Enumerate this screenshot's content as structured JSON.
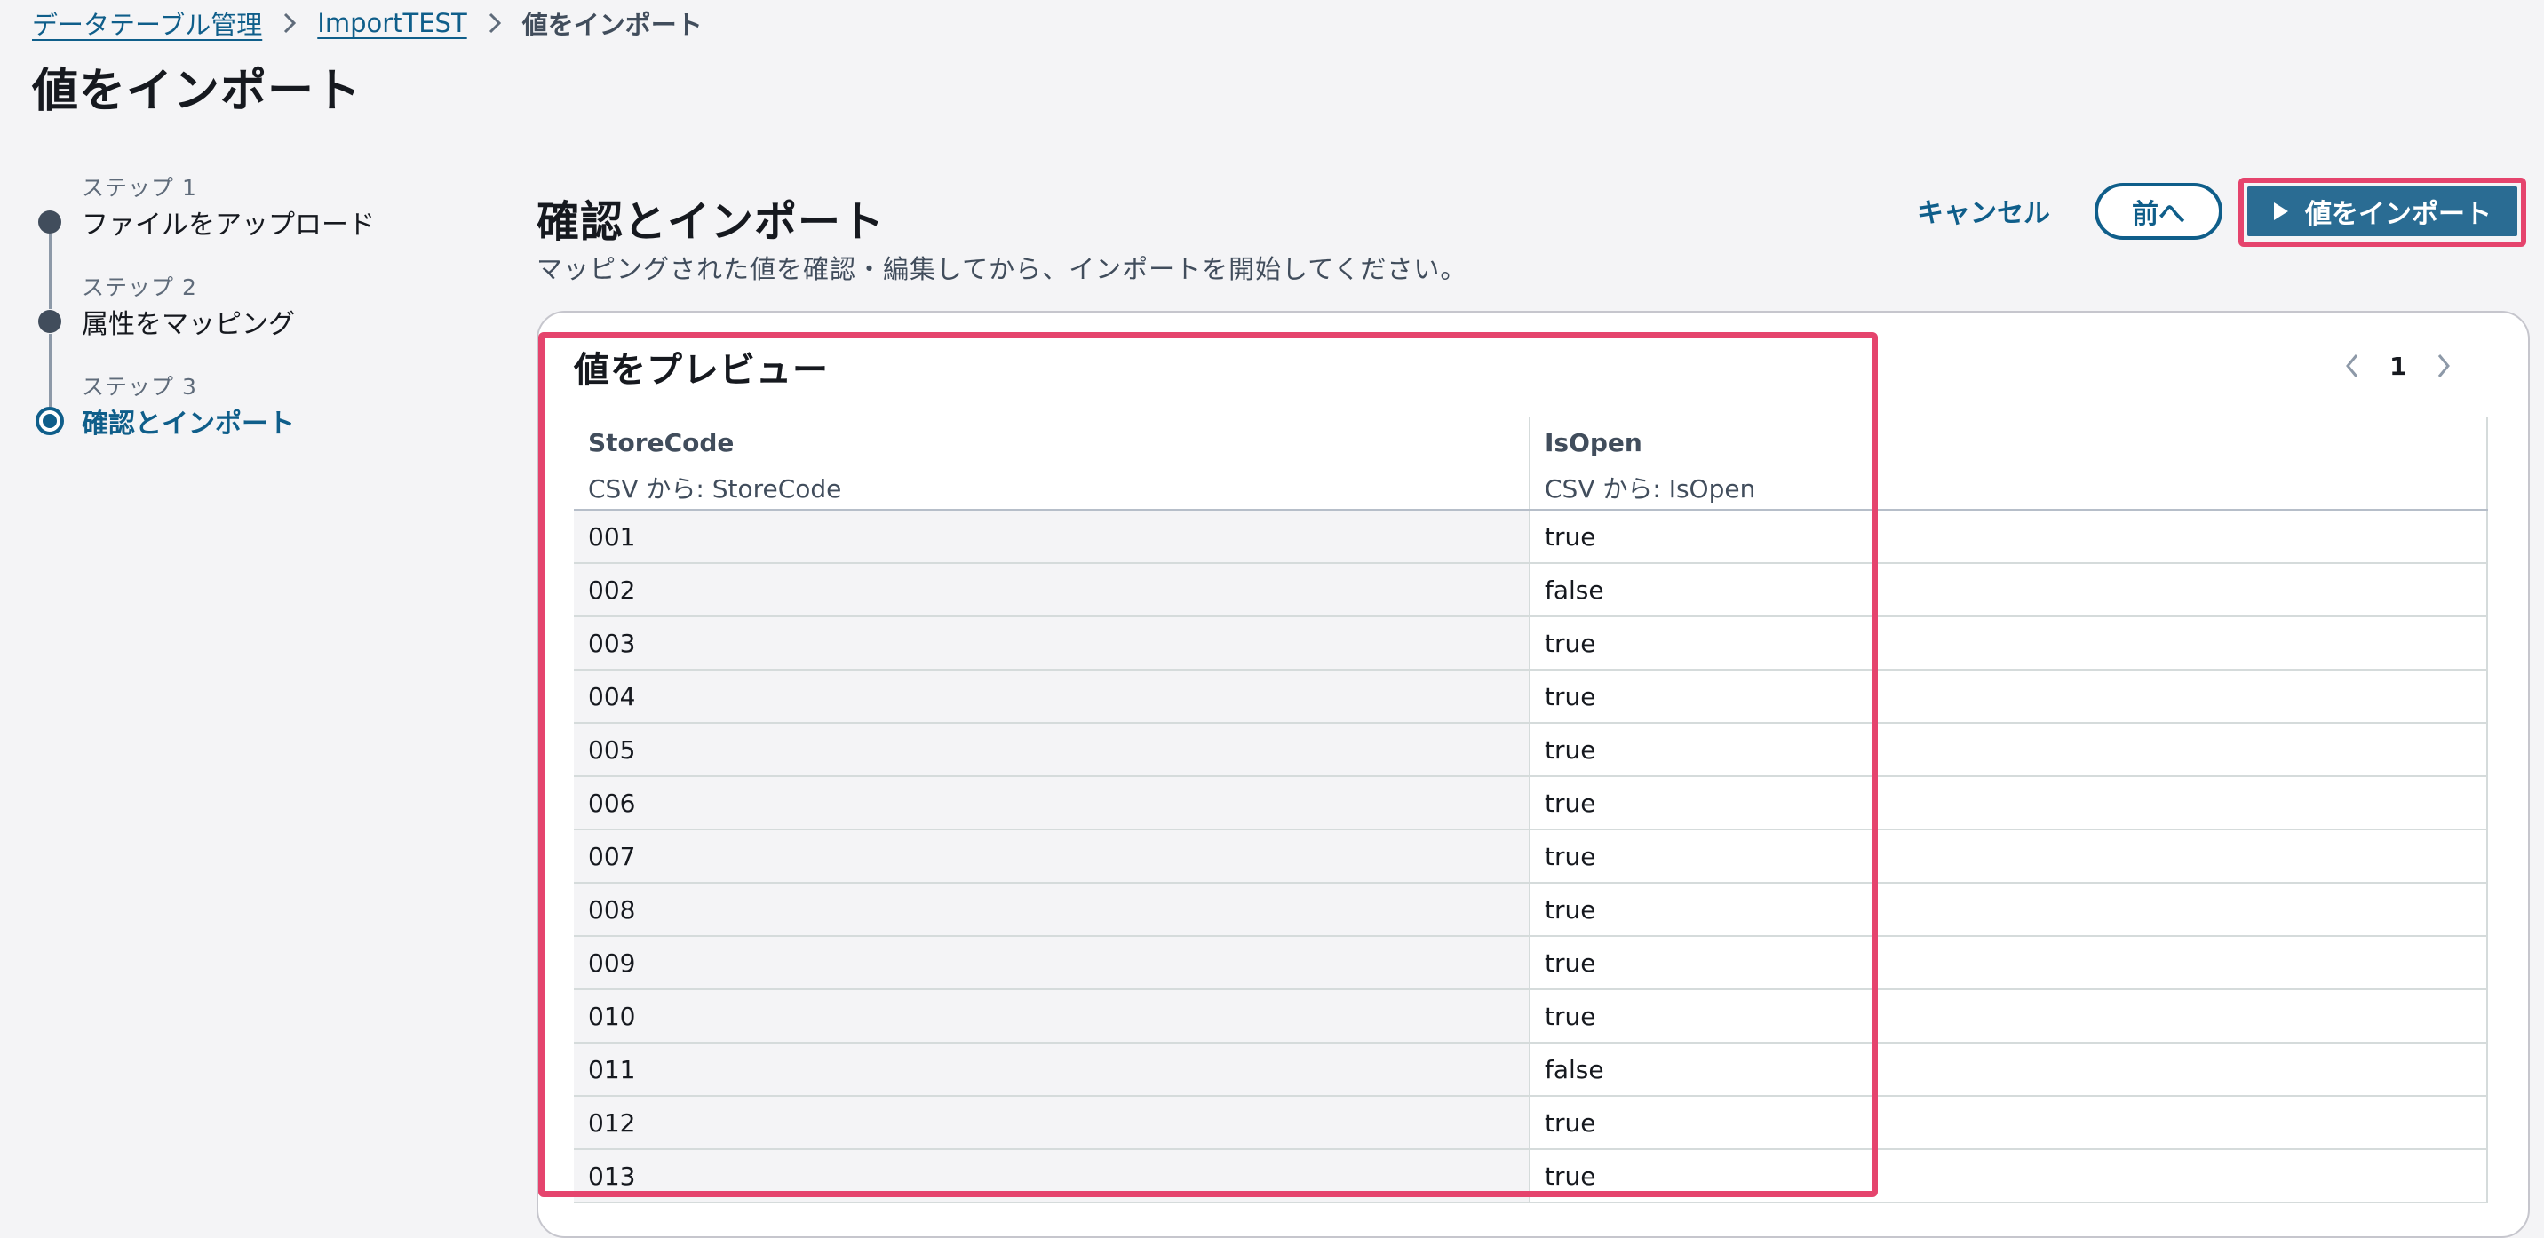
{
  "breadcrumb": {
    "items": [
      "データテーブル管理",
      "ImportTEST"
    ],
    "current": "値をインポート"
  },
  "page_title": "値をインポート",
  "steps": [
    {
      "caption": "ステップ 1",
      "label": "ファイルをアップロード",
      "state": "complete"
    },
    {
      "caption": "ステップ 2",
      "label": "属性をマッピング",
      "state": "complete"
    },
    {
      "caption": "ステップ 3",
      "label": "確認とインポート",
      "state": "active"
    }
  ],
  "section": {
    "title": "確認とインポート",
    "description": "マッピングされた値を確認・編集してから、インポートを開始してください。"
  },
  "actions": {
    "cancel": "キャンセル",
    "previous": "前へ",
    "import": "値をインポート"
  },
  "preview": {
    "title": "値をプレビュー",
    "page": "1",
    "columns": [
      {
        "name": "StoreCode",
        "source": "CSV から: StoreCode"
      },
      {
        "name": "IsOpen",
        "source": "CSV から: IsOpen"
      }
    ],
    "rows": [
      [
        "001",
        "true"
      ],
      [
        "002",
        "false"
      ],
      [
        "003",
        "true"
      ],
      [
        "004",
        "true"
      ],
      [
        "005",
        "true"
      ],
      [
        "006",
        "true"
      ],
      [
        "007",
        "true"
      ],
      [
        "008",
        "true"
      ],
      [
        "009",
        "true"
      ],
      [
        "010",
        "true"
      ],
      [
        "011",
        "false"
      ],
      [
        "012",
        "true"
      ],
      [
        "013",
        "true"
      ]
    ]
  },
  "colors": {
    "primary": "#0f5e8a",
    "import_button": "#2a6c93",
    "highlight": "#e5446d",
    "background": "#f4f4f6"
  },
  "icons": {
    "breadcrumb_separator": "chevron-right-icon",
    "import_button": "play-icon",
    "pagination_prev": "chevron-left-icon",
    "pagination_next": "chevron-right-icon"
  }
}
